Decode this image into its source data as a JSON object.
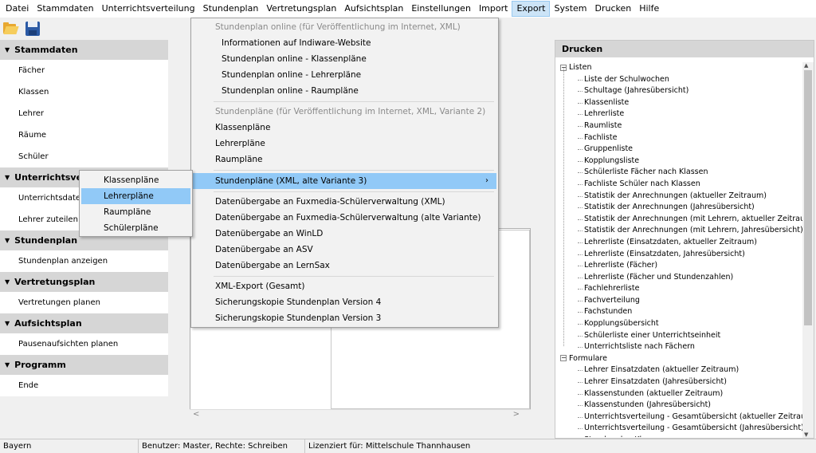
{
  "menubar": {
    "items": [
      "Datei",
      "Stammdaten",
      "Unterrichtsverteilung",
      "Stundenplan",
      "Vertretungsplan",
      "Aufsichtsplan",
      "Einstellungen",
      "Import",
      "Export",
      "System",
      "Drucken",
      "Hilfe"
    ],
    "active": "Export"
  },
  "toolbar": {
    "open_icon": "folder-open-icon",
    "save_icon": "save-disk-icon"
  },
  "leftnav": {
    "groups": [
      {
        "title": "Stammdaten",
        "items": [
          "Fächer",
          "Klassen",
          "Lehrer",
          "Räume",
          "Schüler"
        ]
      },
      {
        "title": "Unterrichtsverte",
        "items": [
          "Unterrichtsdatei",
          "Lehrer zuteilen"
        ]
      },
      {
        "title": "Stundenplan",
        "items": [
          "Stundenplan anzeigen"
        ]
      },
      {
        "title": "Vertretungsplan",
        "items": [
          "Vertretungen planen"
        ]
      },
      {
        "title": "Aufsichtsplan",
        "items": [
          "Pausenaufsichten planen"
        ]
      },
      {
        "title": "Programm",
        "items": [
          "Ende"
        ]
      }
    ]
  },
  "export_menu": {
    "section1_header": "Stundenplan online (für Veröffentlichung im Internet, XML)",
    "section1_items": [
      "Informationen auf Indiware-Website",
      "Stundenplan online - Klassenpläne",
      "Stundenplan online - Lehrerpläne",
      "Stundenplan online - Raumpläne"
    ],
    "section2_header": "Stundenpläne (für Veröffentlichung im Internet, XML, Variante 2)",
    "section2_items": [
      "Klassenpläne",
      "Lehrerpläne",
      "Raumpläne"
    ],
    "section3_item": "Stundenpläne (XML, alte Variante 3)",
    "section4_items": [
      "Datenübergabe an Fuxmedia-Schülerverwaltung (XML)",
      "Datenübergabe an Fuxmedia-Schülerverwaltung (alte Variante)",
      "Datenübergabe an WinLD",
      "Datenübergabe an ASV",
      "Datenübergabe an LernSax"
    ],
    "section5_items": [
      "XML-Export (Gesamt)",
      "Sicherungskopie Stundenplan Version 4",
      "Sicherungskopie Stundenplan Version 3"
    ]
  },
  "submenu": {
    "items": [
      "Klassenpläne",
      "Lehrerpläne",
      "Raumpläne",
      "Schülerpläne"
    ],
    "highlighted_index": 1
  },
  "print_panel": {
    "title": "Drucken",
    "listen_label": "Listen",
    "listen_items": [
      "Liste der Schulwochen",
      "Schultage (Jahresübersicht)",
      "Klassenliste",
      "Lehrerliste",
      "Raumliste",
      "Fachliste",
      "Gruppenliste",
      "Kopplungsliste",
      "Schülerliste Fächer nach Klassen",
      "Fachliste Schüler nach Klassen",
      "Statistik der Anrechnungen (aktueller Zeitraum)",
      "Statistik der Anrechnungen (Jahresübersicht)",
      "Statistik der Anrechnungen (mit Lehrern, aktueller Zeitraum)",
      "Statistik der Anrechnungen (mit Lehrern, Jahresübersicht)",
      "Lehrerliste (Einsatzdaten, aktueller Zeitraum)",
      "Lehrerliste (Einsatzdaten, Jahresübersicht)",
      "Lehrerliste (Fächer)",
      "Lehrerliste (Fächer und Stundenzahlen)",
      "Fachlehrerliste",
      "Fachverteilung",
      "Fachstunden",
      "Kopplungsübersicht",
      "Schülerliste einer Unterrichtseinheit",
      "Unterrichtsliste nach Fächern"
    ],
    "formulare_label": "Formulare",
    "formulare_items": [
      "Lehrer Einsatzdaten (aktueller Zeitraum)",
      "Lehrer Einsatzdaten (Jahresübersicht)",
      "Klassenstunden (aktueller Zeitraum)",
      "Klassenstunden (Jahresübersicht)",
      "Unterrichtsverteilung - Gesamtübersicht (aktueller Zeitraum)",
      "Unterrichtsverteilung - Gesamtübersicht (Jahresübersicht)",
      "Stundenplan Klasse"
    ]
  },
  "statusbar": {
    "region": "Bayern",
    "user": "Benutzer: Master, Rechte: Schreiben",
    "license": "Lizenziert für: Mittelschule Thannhausen"
  },
  "colors": {
    "menu_highlight": "#91c9f7",
    "active_menu": "#cce4f7",
    "nav_header": "#d6d6d6"
  }
}
